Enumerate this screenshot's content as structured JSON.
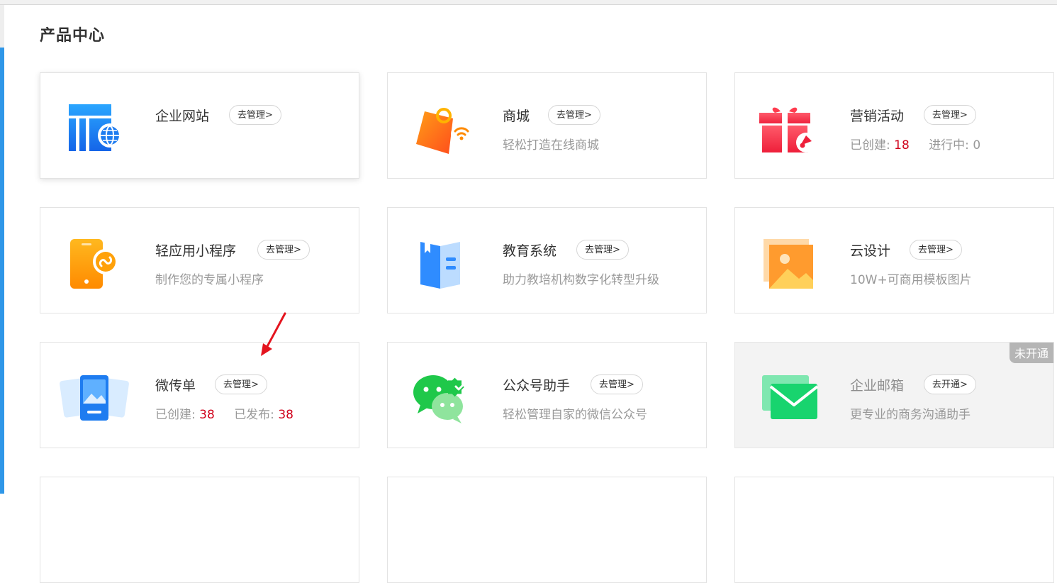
{
  "page": {
    "title": "产品中心"
  },
  "cards": [
    {
      "name": "企业网站",
      "action": "去管理>"
    },
    {
      "name": "商城",
      "action": "去管理>",
      "desc": "轻松打造在线商城"
    },
    {
      "name": "营销活动",
      "action": "去管理>",
      "stat1_label": "已创建:",
      "stat1_value": "18",
      "stat2_label": "进行中:",
      "stat2_value": "0"
    },
    {
      "name": "轻应用小程序",
      "action": "去管理>",
      "desc": "制作您的专属小程序"
    },
    {
      "name": "教育系统",
      "action": "去管理>",
      "desc": "助力教培机构数字化转型升级"
    },
    {
      "name": "云设计",
      "action": "去管理>",
      "desc": "10W+可商用模板图片"
    },
    {
      "name": "微传单",
      "action": "去管理>",
      "stat1_label": "已创建:",
      "stat1_value": "38",
      "stat2_label": "已发布:",
      "stat2_value": "38"
    },
    {
      "name": "公众号助手",
      "action": "去管理>",
      "desc": "轻松管理自家的微信公众号"
    },
    {
      "name": "企业邮箱",
      "action": "去开通>",
      "desc": "更专业的商务沟通助手",
      "badge": "未开通"
    }
  ],
  "icons": [
    "website-icon",
    "shop-bag-icon",
    "gift-icon",
    "mini-program-phone-icon",
    "education-book-icon",
    "image-design-icon",
    "flyer-icon",
    "wechat-icon",
    "mail-icon"
  ],
  "colors": {
    "accent_blue": "#2f97e8",
    "stat_red": "#d0021b",
    "muted_text": "#999999"
  }
}
